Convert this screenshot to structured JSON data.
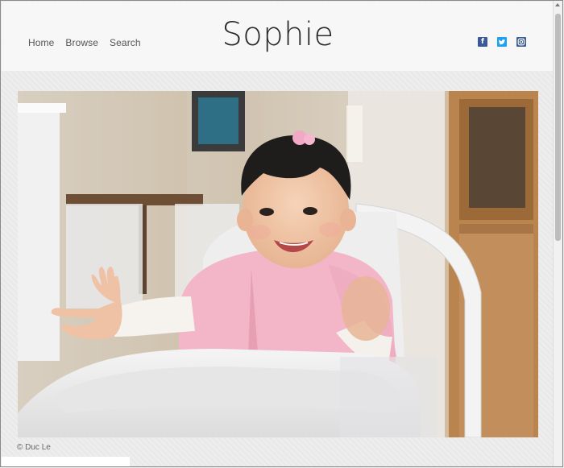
{
  "nav": {
    "items": [
      "Home",
      "Browse",
      "Search"
    ]
  },
  "site": {
    "title": "Sophie"
  },
  "social": [
    {
      "name": "facebook",
      "glyph": "f",
      "color": "#3b5998"
    },
    {
      "name": "twitter",
      "glyph": "t",
      "color": "#1da1f2"
    },
    {
      "name": "instagram",
      "glyph": "",
      "color": "#3f5f8f"
    }
  ],
  "photo": {
    "credit": "© Duc Le"
  },
  "colors": {
    "accent": "#2a2a2a",
    "background": "#ededed"
  }
}
